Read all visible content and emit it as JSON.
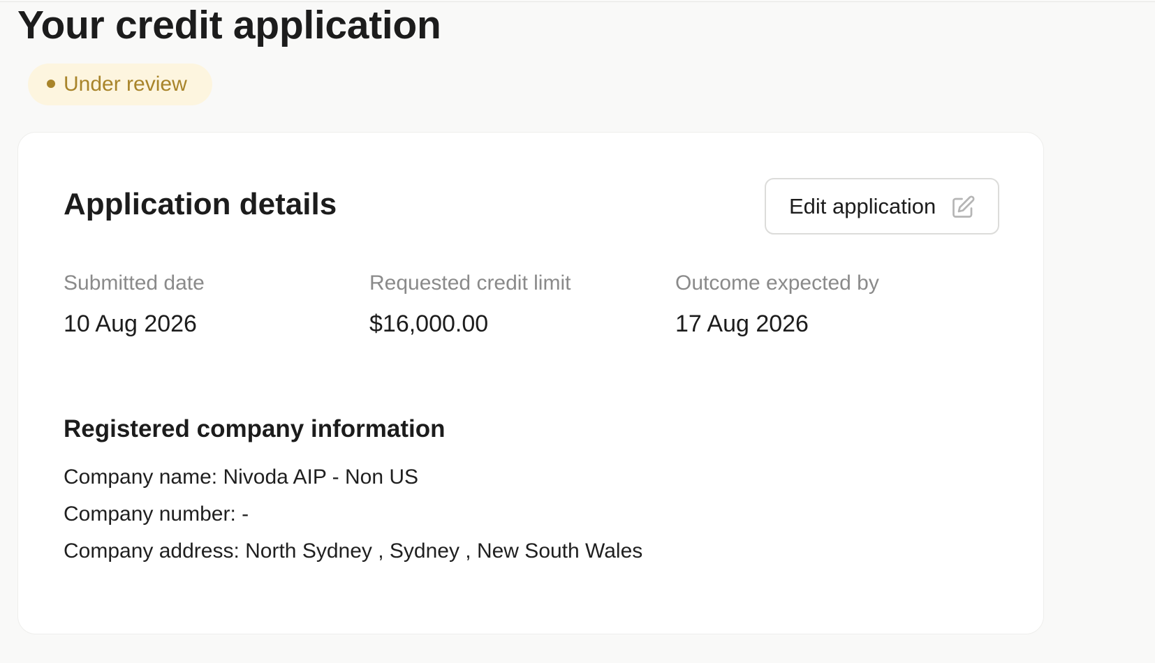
{
  "page": {
    "title": "Your credit application",
    "status": "Under review"
  },
  "colors": {
    "status_text": "#a8842a",
    "status_bg": "#fdf5df",
    "card_bg": "#ffffff",
    "page_bg": "#f9f9f8",
    "muted_text": "#8a8a8a"
  },
  "details": {
    "title": "Application details",
    "edit_button": {
      "label": "Edit application",
      "icon": "edit-icon"
    },
    "fields": [
      {
        "label": "Submitted date",
        "value": "10 Aug 2026"
      },
      {
        "label": "Requested credit limit",
        "value": "$16,000.00"
      },
      {
        "label": "Outcome expected by",
        "value": "17 Aug 2026"
      }
    ]
  },
  "company": {
    "title": "Registered company information",
    "name_line": "Company name: Nivoda AIP - Non US",
    "number_line": "Company number: -",
    "address_line": "Company address: North Sydney , Sydney , New South Wales"
  }
}
